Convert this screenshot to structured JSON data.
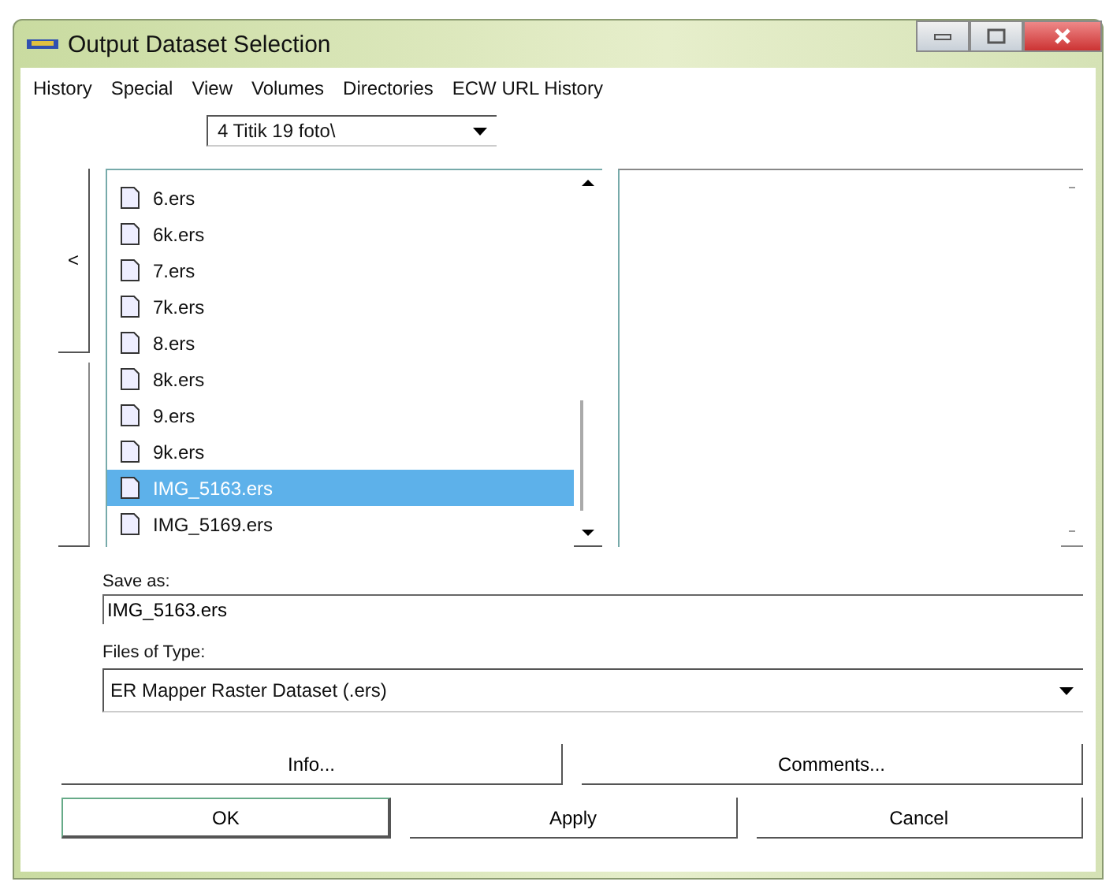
{
  "window": {
    "title": "Output Dataset Selection"
  },
  "menu": [
    "History",
    "Special",
    "View",
    "Volumes",
    "Directories",
    "ECW URL History"
  ],
  "folder": {
    "value": "4 Titik 19 foto\\"
  },
  "nav": {
    "back": "<"
  },
  "files": [
    {
      "name": "6.ers",
      "selected": false
    },
    {
      "name": "6k.ers",
      "selected": false
    },
    {
      "name": "7.ers",
      "selected": false
    },
    {
      "name": "7k.ers",
      "selected": false
    },
    {
      "name": "8.ers",
      "selected": false
    },
    {
      "name": "8k.ers",
      "selected": false
    },
    {
      "name": "9.ers",
      "selected": false
    },
    {
      "name": "9k.ers",
      "selected": false
    },
    {
      "name": "IMG_5163.ers",
      "selected": true
    },
    {
      "name": "IMG_5169.ers",
      "selected": false
    }
  ],
  "save_as": {
    "label": "Save as:",
    "value": "IMG_5163.ers"
  },
  "file_type": {
    "label": "Files of Type:",
    "value": "ER Mapper Raster Dataset (.ers)"
  },
  "info_buttons": [
    "Info...",
    "Comments..."
  ],
  "buttons": [
    "OK",
    "Apply",
    "Cancel"
  ]
}
